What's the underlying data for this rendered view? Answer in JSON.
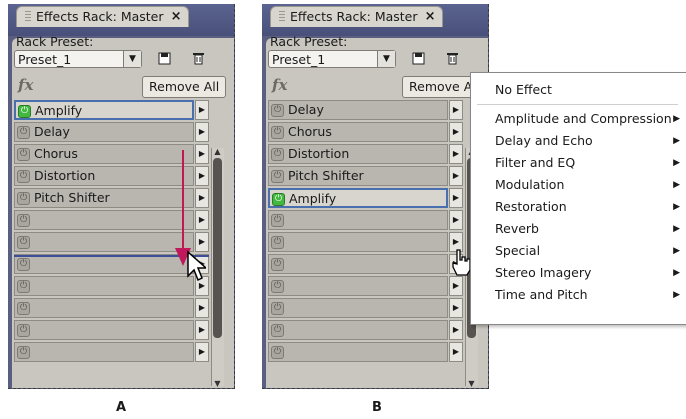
{
  "panel_a": {
    "tab_title": "Effects Rack: Master",
    "close_glyph": "×",
    "rack_preset_label": "Rack Preset:",
    "preset_value": "Preset_1",
    "fx_label": "fx",
    "remove_all_label": "Remove All",
    "slots": [
      "Amplify",
      "Delay",
      "Chorus",
      "Distortion",
      "Pitch Shifter",
      "",
      "",
      "",
      "",
      "",
      "",
      ""
    ],
    "caption": "A"
  },
  "panel_b": {
    "tab_title": "Effects Rack: Master",
    "close_glyph": "×",
    "rack_preset_label": "Rack Preset:",
    "preset_value": "Preset_1",
    "fx_label": "fx",
    "remove_all_label": "Remove A",
    "slots": [
      "Delay",
      "Chorus",
      "Distortion",
      "Pitch Shifter",
      "Amplify",
      "",
      "",
      "",
      "",
      "",
      "",
      ""
    ],
    "caption": "B"
  },
  "effects_menu": {
    "no_effect": "No Effect",
    "categories": [
      "Amplitude and Compression",
      "Delay and Echo",
      "Filter and EQ",
      "Modulation",
      "Restoration",
      "Reverb",
      "Special",
      "Stereo Imagery",
      "Time and Pitch"
    ]
  },
  "icons": {
    "power": "power-icon",
    "save": "save-preset-icon",
    "trash": "delete-preset-icon",
    "submenu": "submenu-arrow-icon",
    "pointer": "arrow-cursor-icon",
    "hand": "hand-cursor-icon"
  },
  "colors": {
    "panel_frame": "#5a5f82",
    "panel_body": "#c9c6c0",
    "power_on": "#42b840",
    "drag_arrow": "#c0185a",
    "drop_line": "#3d4f9a"
  }
}
